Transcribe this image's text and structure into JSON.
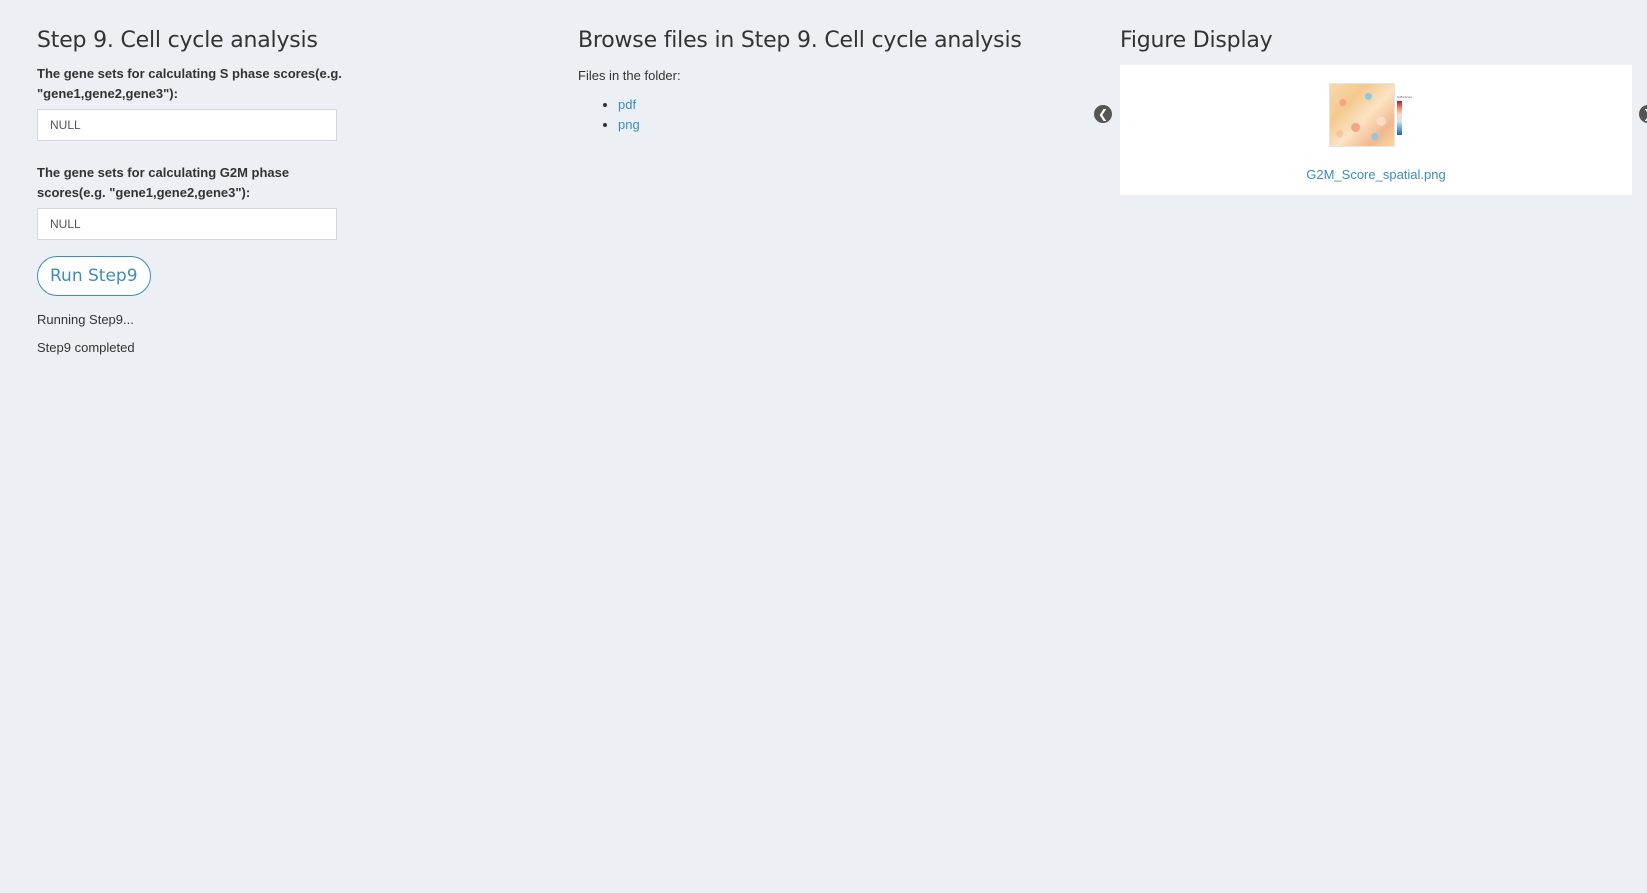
{
  "left_panel": {
    "title": "Step 9. Cell cycle analysis",
    "s_phase_label": "The gene sets for calculating S phase scores(e.g. \"gene1,gene2,gene3\"):",
    "s_phase_value": "NULL",
    "g2m_phase_label": "The gene sets for calculating G2M phase scores(e.g. \"gene1,gene2,gene3\"):",
    "g2m_phase_value": "NULL",
    "run_button_label": "Run Step9",
    "status": [
      "Running Step9...",
      "Step9 completed"
    ]
  },
  "middle_panel": {
    "title": "Browse files in Step 9. Cell cycle analysis",
    "files_label": "Files in the folder:",
    "folders": [
      "pdf",
      "png"
    ]
  },
  "right_panel": {
    "title": "Figure Display",
    "figure_caption": "G2M_Score_spatial.png",
    "prev_icon": "chevron-left-circle-icon",
    "next_icon": "chevron-right-circle-icon",
    "thumbnail_legend_title": "G2M.Score"
  },
  "colors": {
    "background": "#ecf0f5",
    "accent": "#3c8dbc",
    "panel": "#ffffff"
  }
}
